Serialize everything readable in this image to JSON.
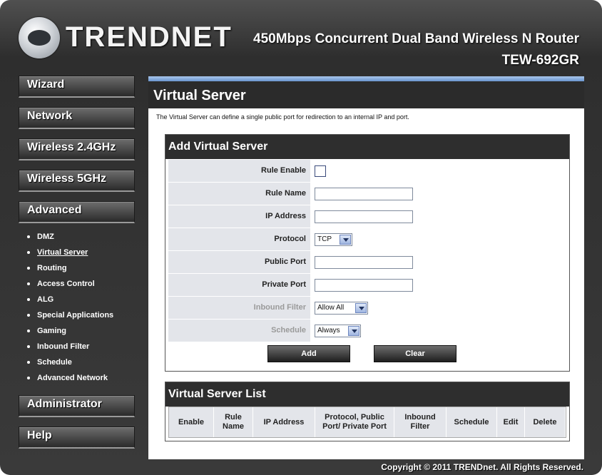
{
  "header": {
    "logo_text": "TRENDNET",
    "product_line": "450Mbps Concurrent Dual Band Wireless N Router",
    "model": "TEW-692GR"
  },
  "nav": {
    "items": [
      {
        "label": "Wizard"
      },
      {
        "label": "Network"
      },
      {
        "label": "Wireless 2.4GHz"
      },
      {
        "label": "Wireless 5GHz"
      },
      {
        "label": "Advanced"
      }
    ],
    "advanced_sub": [
      "DMZ",
      "Virtual Server",
      "Routing",
      "Access Control",
      "ALG",
      "Special Applications",
      "Gaming",
      "Inbound Filter",
      "Schedule",
      "Advanced Network"
    ],
    "bottom_items": [
      {
        "label": "Administrator"
      },
      {
        "label": "Help"
      }
    ]
  },
  "page": {
    "title": "Virtual Server",
    "description": "The Virtual Server can define a single public port for redirection to an internal IP and port."
  },
  "add_form": {
    "heading": "Add Virtual Server",
    "labels": {
      "rule_enable": "Rule Enable",
      "rule_name": "Rule Name",
      "ip_address": "IP Address",
      "protocol": "Protocol",
      "public_port": "Public Port",
      "private_port": "Private Port",
      "inbound_filter": "Inbound Filter",
      "schedule": "Schedule"
    },
    "values": {
      "protocol": "TCP",
      "inbound_filter": "Allow All",
      "schedule": "Always"
    },
    "buttons": {
      "add": "Add",
      "clear": "Clear"
    }
  },
  "list": {
    "heading": "Virtual Server List",
    "columns": [
      "Enable",
      "Rule Name",
      "IP Address",
      "Protocol, Public Port/ Private Port",
      "Inbound Filter",
      "Schedule",
      "Edit",
      "Delete"
    ]
  },
  "footer": {
    "copyright": "Copyright © 2011 TRENDnet. All Rights Reserved."
  }
}
